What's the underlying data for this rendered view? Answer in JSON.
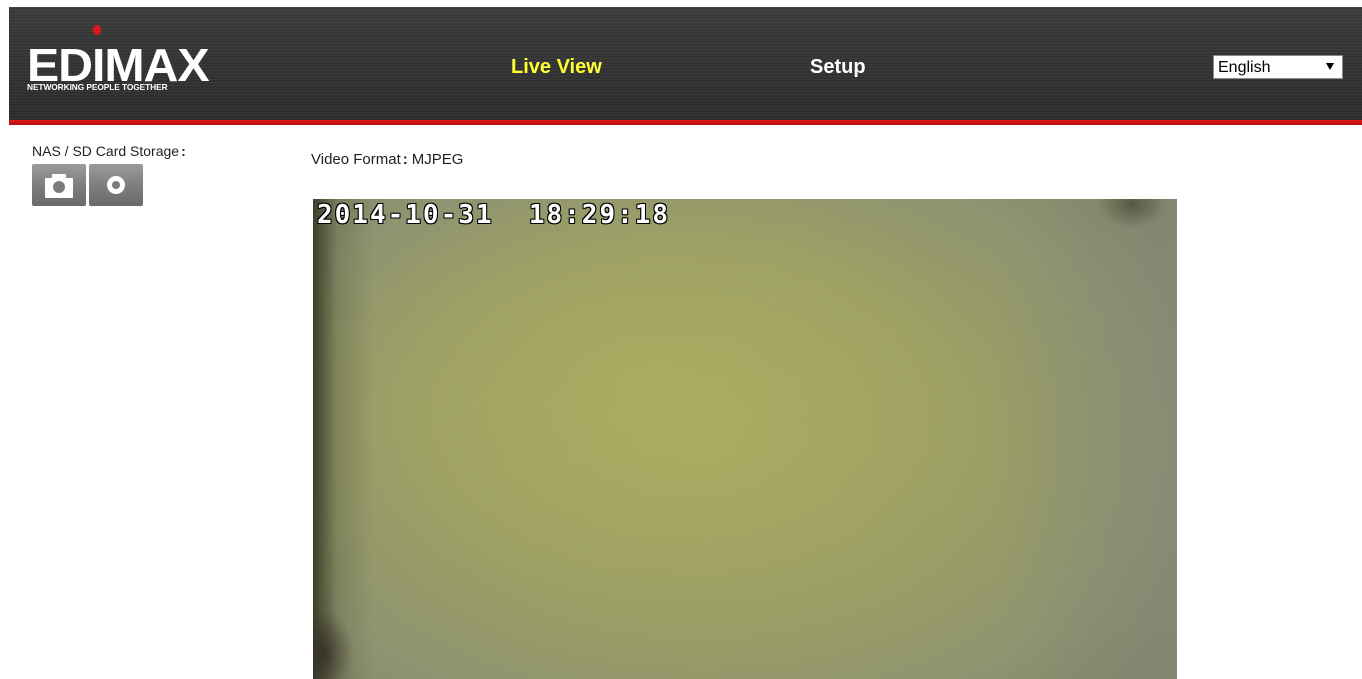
{
  "header": {
    "logo": {
      "wordmark": "EDIMAX",
      "tagline": "NETWORKING PEOPLE TOGETHER"
    },
    "nav": {
      "live_view": "Live View",
      "setup": "Setup"
    },
    "language": {
      "selected": "English"
    }
  },
  "sidebar": {
    "storage_label": "NAS / SD Card Storage",
    "storage_colon": ":"
  },
  "video": {
    "format_label": "Video Format",
    "format_colon": ":",
    "format_value": "MJPEG",
    "timestamp": "2014-10-31  18:29:18"
  },
  "colors": {
    "header_bg": "#333333",
    "header_accent": "#d01010",
    "active_nav": "#ffff33",
    "nav_text": "#ffffff",
    "button_gray": "#7c7c7c"
  },
  "icons": {
    "snapshot": "camera-icon",
    "record": "record-icon",
    "dropdown": "caret-down-icon"
  }
}
